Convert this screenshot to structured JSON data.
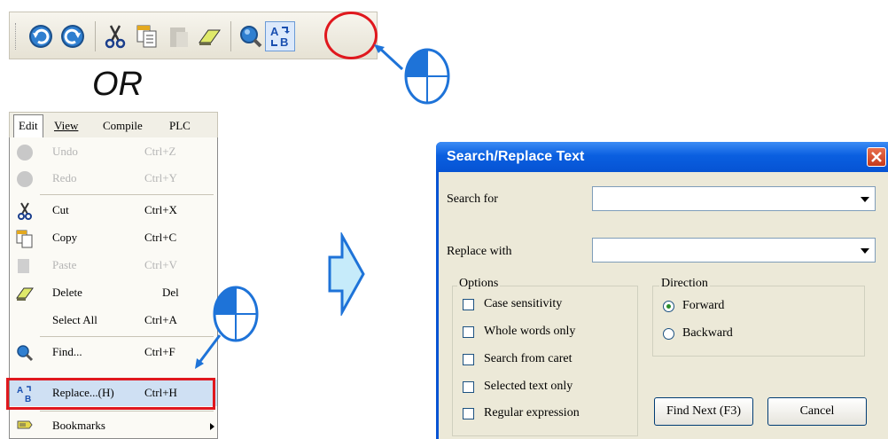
{
  "or_text": "OR",
  "toolbar": {
    "buttons": [
      "undo-icon",
      "redo-icon",
      "cut-icon",
      "copy-icon",
      "paste-icon",
      "eraser-icon",
      "find-icon",
      "replace-icon"
    ]
  },
  "menubar": {
    "items": [
      "Edit",
      "View",
      "Compile",
      "PLC"
    ]
  },
  "menu": {
    "items": [
      {
        "label": "Undo",
        "shortcut": "Ctrl+Z",
        "disabled": true
      },
      {
        "label": "Redo",
        "shortcut": "Ctrl+Y",
        "disabled": true
      },
      {
        "label": "Cut",
        "shortcut": "Ctrl+X",
        "disabled": false
      },
      {
        "label": "Copy",
        "shortcut": "Ctrl+C",
        "disabled": false
      },
      {
        "label": "Paste",
        "shortcut": "Ctrl+V",
        "disabled": true
      },
      {
        "label": "Delete",
        "shortcut": "Del",
        "disabled": false
      },
      {
        "label": "Select All",
        "shortcut": "Ctrl+A",
        "disabled": false
      },
      {
        "label": "Find...",
        "shortcut": "Ctrl+F",
        "disabled": false
      },
      {
        "label": "Replace...(H)",
        "shortcut": "Ctrl+H",
        "disabled": false
      },
      {
        "label": "Bookmarks",
        "shortcut": "",
        "disabled": false
      }
    ]
  },
  "dialog": {
    "title": "Search/Replace Text",
    "search_for_label": "Search for",
    "replace_with_label": "Replace with",
    "search_value": "",
    "replace_value": "",
    "options_label": "Options",
    "options": [
      {
        "label": "Case sensitivity",
        "checked": false
      },
      {
        "label": "Whole words only",
        "checked": false
      },
      {
        "label": "Search from caret",
        "checked": false
      },
      {
        "label": "Selected text only",
        "checked": false
      },
      {
        "label": "Regular expression",
        "checked": false
      }
    ],
    "direction_label": "Direction",
    "directions": [
      {
        "label": "Forward",
        "selected": true
      },
      {
        "label": "Backward",
        "selected": false
      }
    ],
    "find_next_label": "Find Next (F3)",
    "cancel_label": "Cancel"
  },
  "colors": {
    "highlight": "#e0181e",
    "pointer": "#1e73d8",
    "title_bar": "#0a5fe0",
    "dialog_bg": "#ece9d8"
  }
}
